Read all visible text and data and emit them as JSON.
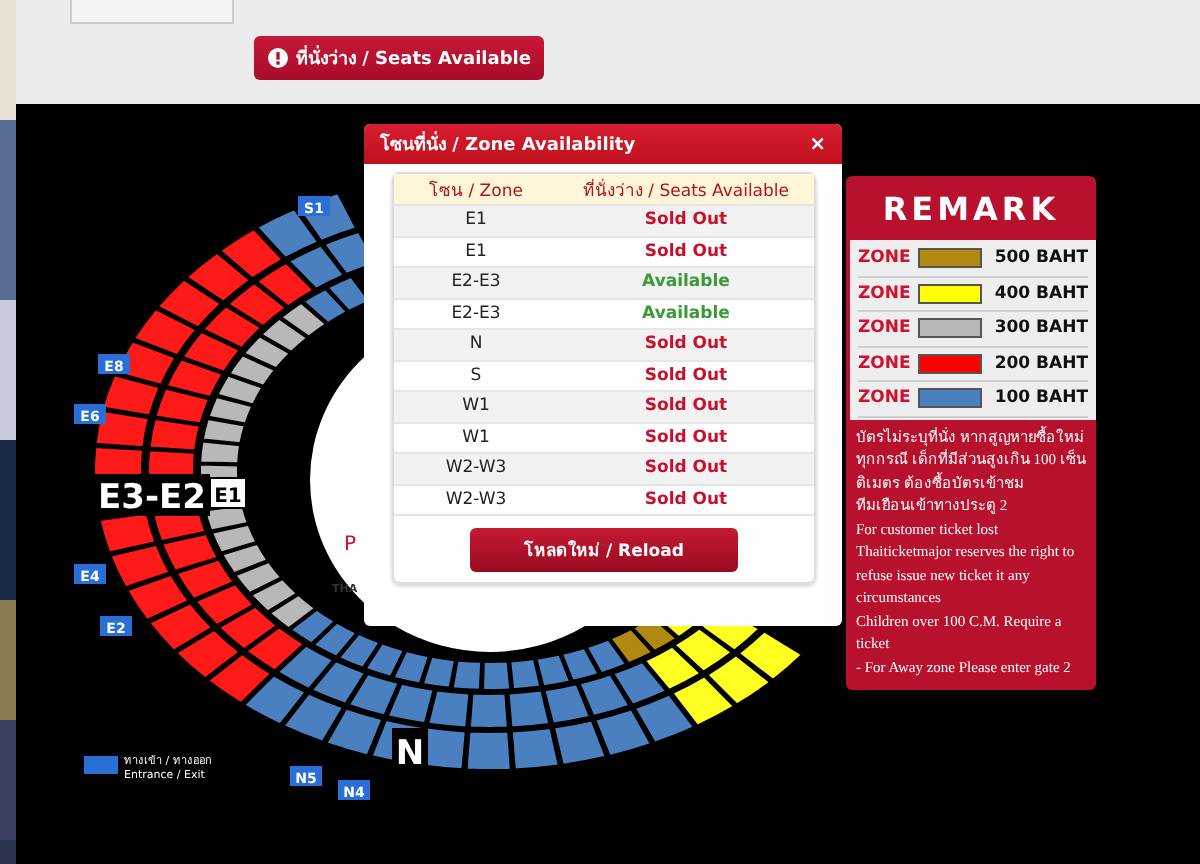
{
  "alert_button": {
    "label": "ที่นั่งว่าง / Seats Available"
  },
  "map": {
    "gates": [
      "S1",
      "E8",
      "E6",
      "E4",
      "E2",
      "N5",
      "N4"
    ],
    "zones": [
      "E3-E2",
      "E1",
      "N"
    ],
    "fragments": [
      "P",
      "THA"
    ],
    "legend": {
      "thai": "ทางเข้า / ทางออก",
      "english": "Entrance / Exit"
    }
  },
  "modal": {
    "title": "โซนที่นั่ง / Zone Availability",
    "close": "×",
    "columns": [
      "โซน / Zone",
      "ที่นั่งว่าง / Seats Available"
    ],
    "rows": [
      {
        "zone": "E1",
        "status": "Sold Out",
        "kind": "sold_out"
      },
      {
        "zone": "E1",
        "status": "Sold Out",
        "kind": "sold_out"
      },
      {
        "zone": "E2-E3",
        "status": "Available",
        "kind": "available"
      },
      {
        "zone": "E2-E3",
        "status": "Available",
        "kind": "available"
      },
      {
        "zone": "N",
        "status": "Sold Out",
        "kind": "sold_out"
      },
      {
        "zone": "S",
        "status": "Sold Out",
        "kind": "sold_out"
      },
      {
        "zone": "W1",
        "status": "Sold Out",
        "kind": "sold_out"
      },
      {
        "zone": "W1",
        "status": "Sold Out",
        "kind": "sold_out"
      },
      {
        "zone": "W2-W3",
        "status": "Sold Out",
        "kind": "sold_out"
      },
      {
        "zone": "W2-W3",
        "status": "Sold Out",
        "kind": "sold_out"
      }
    ],
    "reload": "โหลดใหม่ / Reload"
  },
  "remark": {
    "title": "REMARK",
    "prices": [
      {
        "label": "ZONE",
        "color": "#b08a10",
        "price": "500 BAHT"
      },
      {
        "label": "ZONE",
        "color": "#ffff00",
        "price": "400 BAHT"
      },
      {
        "label": "ZONE",
        "color": "#b8b8b8",
        "price": "300 BAHT"
      },
      {
        "label": "ZONE",
        "color": "#ff0000",
        "price": "200 BAHT"
      },
      {
        "label": "ZONE",
        "color": "#4a7fc0",
        "price": "100 BAHT"
      }
    ],
    "notes": [
      "บัตรไม่ระบุที่นั่ง หากสูญหายซื้อใหม่ทุกกรณี เด็กที่มีส่วนสูงเกิน 100 เซ็นติเมตร ต้องซื้อบัตรเข้าชม",
      "ทีมเยือนเข้าทางประตู 2",
      "For customer  ticket  lost",
      "Thaiticketmajor reserves the right to refuse issue new ticket it any circumstances",
      "Children over 100 C.M. Require a ticket",
      "- For Away zone Please enter gate 2"
    ]
  }
}
